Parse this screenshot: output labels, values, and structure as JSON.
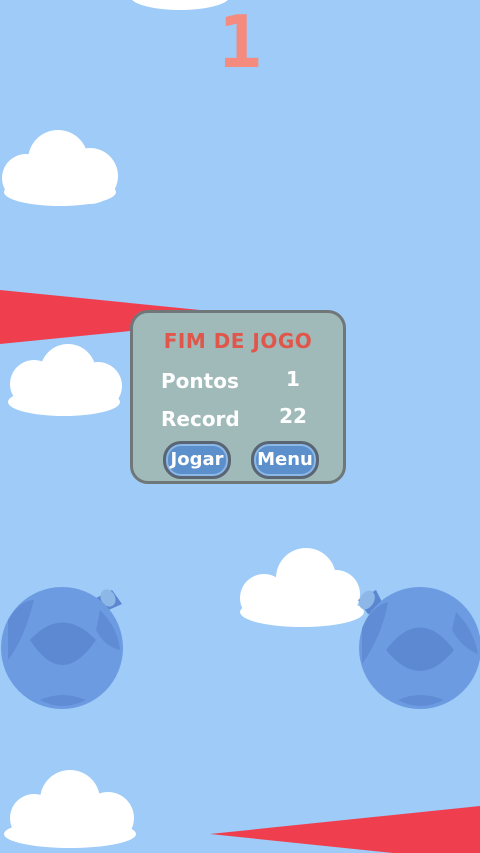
{
  "hud": {
    "score": "1"
  },
  "game_over": {
    "title": "FIM DE JOGO",
    "points_label": "Pontos",
    "points_value": "1",
    "record_label": "Record",
    "record_value": "22",
    "play_button": "Jogar",
    "menu_button": "Menu"
  },
  "colors": {
    "sky": "#9ecbf7",
    "score": "#f58a7e",
    "spike": "#ef3f4e",
    "balloon": "#6d9be2",
    "balloon_dark": "#5b86d0",
    "cloud": "#ffffff"
  }
}
